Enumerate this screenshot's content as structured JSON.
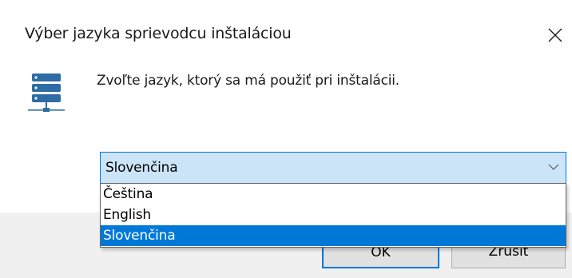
{
  "window": {
    "title": "Výber jazyka sprievodcu inštaláciou",
    "close_icon": "close-icon"
  },
  "app_icon": "server-network-icon",
  "prompt": "Zvoľte jazyk, ktorý sa má použiť pri inštalácii.",
  "language_select": {
    "selected": "Slovenčina",
    "options": [
      "Čeština",
      "English",
      "Slovenčina"
    ],
    "highlighted_index": 2
  },
  "buttons": {
    "ok_label": "OK",
    "cancel_label": "Zrušiť"
  },
  "colors": {
    "accent": "#0078d7",
    "combo_background": "#cce4f7",
    "footer_background": "#f0f0f0"
  }
}
